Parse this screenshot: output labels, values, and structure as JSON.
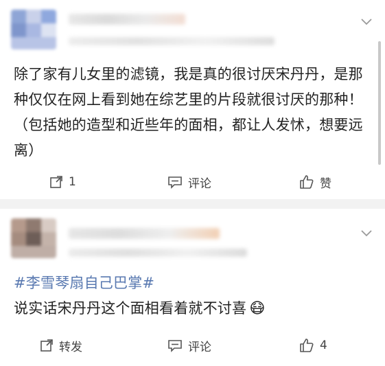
{
  "posts": [
    {
      "text": "除了家有儿女里的滤镜，我是真的很讨厌宋丹丹，是那种仅仅在网上看到她在综艺里的片段就很讨厌的那种！（包括她的造型和近些年的面相，都让人发怵，想要远离）",
      "repost_count": "1",
      "comment_label": "评论",
      "like_label": "赞",
      "menu_icon": "chevron-down-icon"
    },
    {
      "hashtag": "#李雪琴扇自己巴掌#",
      "text": "说实话宋丹丹这个面相看着就不讨喜",
      "emoji": "😷",
      "repost_label": "转发",
      "comment_label": "评论",
      "like_count": "4",
      "menu_icon": "chevron-down-icon"
    }
  ],
  "colors": {
    "hashtag": "#5878b0",
    "separator": "#f2f2f2",
    "text": "#222222",
    "action_text": "#444444"
  }
}
